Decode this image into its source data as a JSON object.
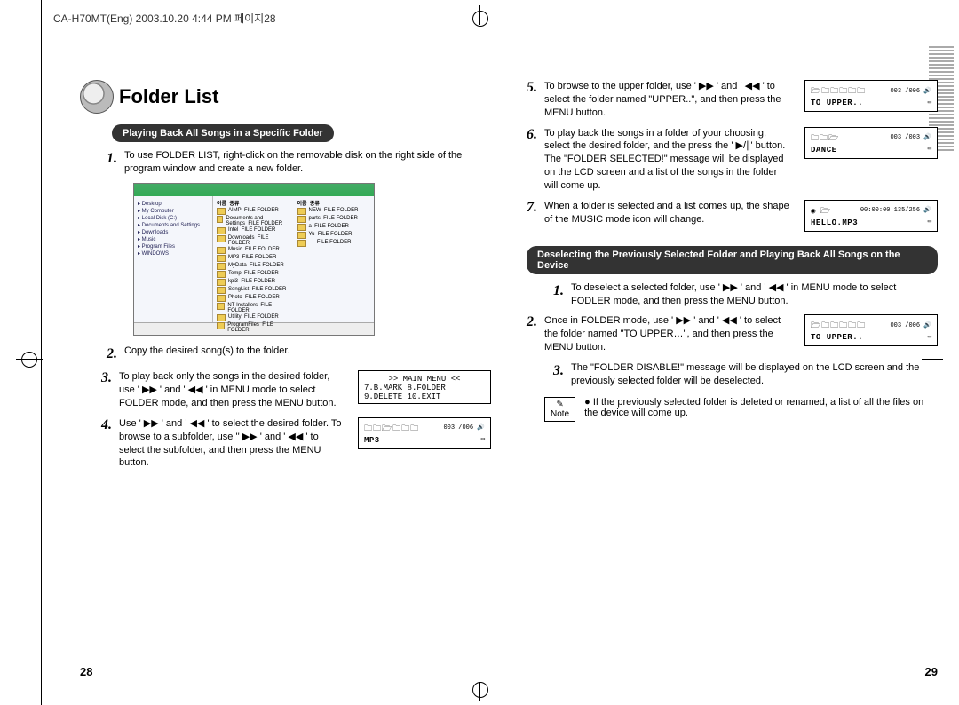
{
  "header": "CA-H70MT(Eng)  2003.10.20  4:44 PM  페이지28",
  "title": "Folder List",
  "section1": "Playing Back All Songs in a Specific Folder",
  "section2": "Deselecting the Previously Selected Folder and Playing Back All Songs on the Device",
  "left": {
    "s1": "To use FOLDER LIST, right-click on the removable disk on the right side of the program window and create a new folder.",
    "s2": "Copy the desired song(s) to the folder.",
    "s3": "To play back only the songs in the desired folder, use ' ▶▶ ' and ' ◀◀ ' in MENU mode to select FOLDER mode, and then press the MENU button.",
    "s4": "Use ' ▶▶ ' and ' ◀◀ ' to select the desired folder. To browse to a subfolder, use '' ▶▶ ' and ' ◀◀ ' to select the subfolder, and then press the MENU button."
  },
  "rightTop": {
    "s5": "To browse to the upper folder, use ' ▶▶ ' and ' ◀◀ ' to select the folder named \"UPPER..\", and then press the MENU button.",
    "s6": "To play back the songs in a folder of your choosing, select the desired folder, and the press the  ' ▶/∥' button. The \"FOLDER SELECTED!\" message will be displayed on the LCD screen and a list of the songs in the folder will come up.",
    "s7": "When a folder is selected and a list comes up, the shape of the MUSIC mode icon will change."
  },
  "rightBottom": {
    "s1": "To deselect a selected folder, use ' ▶▶ ' and ' ◀◀ ' in MENU mode to select FODLER mode, and then press the MENU button.",
    "s2": "Once in FOLDER mode, use  ' ▶▶ ' and ' ◀◀ ' to select the folder named \"TO UPPER…\", and then press the MENU button.",
    "s3": "The \"FOLDER DISABLE!\" message will be displayed on the LCD screen and the previously selected folder will be deselected."
  },
  "lcd": {
    "mainmenu_l1": ">> MAIN  MENU <<",
    "mainmenu_l2": "7.B.MARK   8.FOLDER",
    "mainmenu_l3": "9.DELETE    10.EXIT",
    "mp3_folders": "🗀🗀🗁🗀🗀🗀",
    "mp3_count": "003 /006",
    "mp3_label": "MP3",
    "upper_folders": "🗁🗀🗀🗀🗀🗀",
    "upper_count": "003 /006",
    "upper_label": "TO UPPER..",
    "dance_folders": "🗀🗀🗁",
    "dance_count": "003 /003",
    "dance_label": "DANCE",
    "hello_icons": "◉ 🗁",
    "hello_time": "00:00:00 135/256",
    "hello_label": "HELLO.MP3",
    "upper2_folders": "🗁🗀🗀🗀🗀🗀",
    "upper2_count": "003 /006",
    "upper2_label": "TO UPPER.."
  },
  "note_label": "Note",
  "note_text": "If the previously selected folder is deleted or renamed, a list of all the files on the device will come up.",
  "page_left": "28",
  "page_right": "29",
  "fs_tree": [
    "▸ Desktop",
    "  ▸ My Computer",
    "    ▸ Local Disk (C:)",
    "    ▸ Documents and Settings",
    "    ▸ Downloads",
    "    ▸ Music",
    "    ▸ Program Files",
    "    ▸ WINDOWS"
  ],
  "fs_cols": {
    "name_h": "이름",
    "type_h": "종류",
    "names": [
      "AIMP",
      "Documents and Settings",
      "Intel",
      "Downloads",
      "Music",
      "MP3",
      "MyData",
      "Temp",
      "kpi3",
      "SongList",
      "Photo",
      "NT-Installers",
      "Utility",
      "ProgramFiles"
    ],
    "type": "FILE FOLDER",
    "names2": [
      "NEW",
      "parts",
      "a",
      "Yu",
      "—"
    ]
  }
}
